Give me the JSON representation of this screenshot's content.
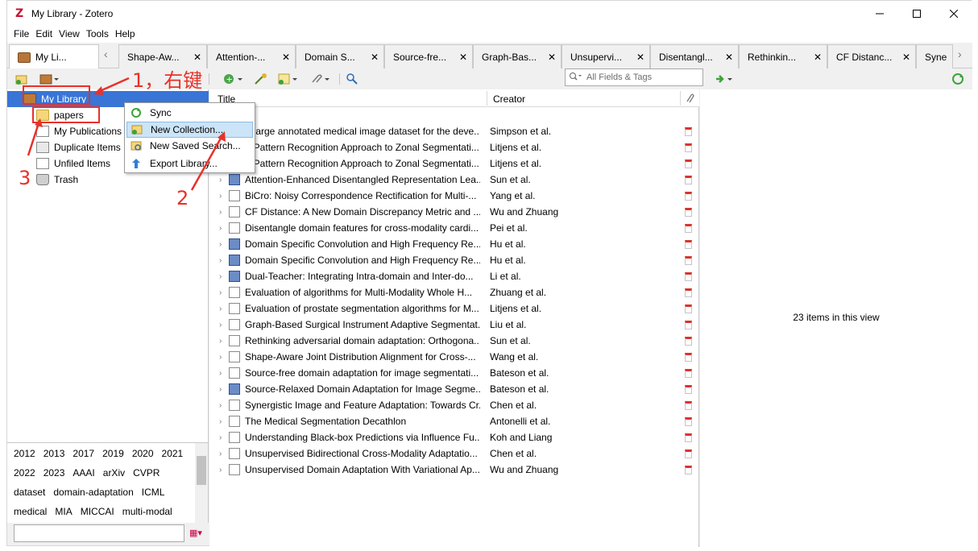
{
  "window": {
    "title": "My Library - Zotero",
    "logo": "Z",
    "minimize_icon": "minimize-icon",
    "maximize_icon": "maximize-icon",
    "close_icon": "close-icon"
  },
  "menu": [
    "File",
    "Edit",
    "View",
    "Tools",
    "Help"
  ],
  "tabs": [
    {
      "label": "My Li...",
      "active": true
    },
    {
      "label": "Shape-Aw..."
    },
    {
      "label": "Attention-..."
    },
    {
      "label": "Domain S..."
    },
    {
      "label": "Source-fre..."
    },
    {
      "label": "Graph-Bas..."
    },
    {
      "label": "Unsupervi..."
    },
    {
      "label": "Disentangl..."
    },
    {
      "label": "Rethinkin..."
    },
    {
      "label": "CF Distanc..."
    },
    {
      "label": "Syne"
    }
  ],
  "toolbar": {
    "search_placeholder": "All Fields & Tags"
  },
  "collections": [
    {
      "label": "My Library",
      "icon": "library-icon",
      "selected": true
    },
    {
      "label": "papers",
      "icon": "folder-icon"
    },
    {
      "label": "My Publications",
      "icon": "publications-icon"
    },
    {
      "label": "Duplicate Items",
      "icon": "duplicate-icon"
    },
    {
      "label": "Unfiled Items",
      "icon": "unfiled-icon"
    },
    {
      "label": "Trash",
      "icon": "trash-icon"
    }
  ],
  "context_menu": [
    {
      "label": "Sync",
      "icon": "sync-icon"
    },
    {
      "label": "New Collection...",
      "icon": "new-collection-icon",
      "highlighted": true
    },
    {
      "label": "New Saved Search...",
      "icon": "new-saved-search-icon"
    },
    {
      "label": "Export Library...",
      "icon": "export-icon"
    }
  ],
  "tags": [
    [
      "2012",
      "2013",
      "2017",
      "2019",
      "2020",
      "2021"
    ],
    [
      "2022",
      "2023",
      "AAAI",
      "arXiv",
      "CVPR"
    ],
    [
      "dataset",
      "domain-adaptation",
      "ICML"
    ],
    [
      "medical",
      "MIA",
      "MICCAI",
      "multi-modal"
    ]
  ],
  "items_pane": {
    "col_title": "Title",
    "col_creator": "Creator",
    "count_text": "23 items in this view",
    "rows": [
      {
        "title": "A large annotated medical image dataset for the deve...",
        "creator": "Simpson et al.",
        "type": "doc"
      },
      {
        "title": "A Pattern Recognition Approach to Zonal Segmentati...",
        "creator": "Litjens et al.",
        "type": "doc"
      },
      {
        "title": "A Pattern Recognition Approach to Zonal Segmentati...",
        "creator": "Litjens et al.",
        "type": "doc"
      },
      {
        "title": "Attention-Enhanced Disentangled Representation Lea...",
        "creator": "Sun et al.",
        "type": "book"
      },
      {
        "title": "BiCro: Noisy Correspondence Rectification for Multi-...",
        "creator": "Yang et al.",
        "type": "doc"
      },
      {
        "title": "CF Distance: A New Domain Discrepancy Metric and ...",
        "creator": "Wu and Zhuang",
        "type": "doc"
      },
      {
        "title": "Disentangle domain features for cross-modality cardi...",
        "creator": "Pei et al.",
        "type": "doc"
      },
      {
        "title": "Domain Specific Convolution and High Frequency Re...",
        "creator": "Hu et al.",
        "type": "book"
      },
      {
        "title": "Domain Specific Convolution and High Frequency Re...",
        "creator": "Hu et al.",
        "type": "book"
      },
      {
        "title": "Dual-Teacher: Integrating Intra-domain and Inter-do...",
        "creator": "Li et al.",
        "type": "book"
      },
      {
        "title": "Evaluation of algorithms for Multi-Modality Whole H...",
        "creator": "Zhuang et al.",
        "type": "doc"
      },
      {
        "title": "Evaluation of prostate segmentation algorithms for M...",
        "creator": "Litjens et al.",
        "type": "doc"
      },
      {
        "title": "Graph-Based Surgical Instrument Adaptive Segmentat...",
        "creator": "Liu et al.",
        "type": "doc"
      },
      {
        "title": "Rethinking adversarial domain adaptation: Orthogona...",
        "creator": "Sun et al.",
        "type": "doc"
      },
      {
        "title": "Shape-Aware Joint Distribution Alignment for Cross-...",
        "creator": "Wang et al.",
        "type": "doc"
      },
      {
        "title": "Source-free domain adaptation for image segmentati...",
        "creator": "Bateson et al.",
        "type": "doc"
      },
      {
        "title": "Source-Relaxed Domain Adaptation for Image Segme...",
        "creator": "Bateson et al.",
        "type": "book"
      },
      {
        "title": "Synergistic Image and Feature Adaptation: Towards Cr...",
        "creator": "Chen et al.",
        "type": "doc"
      },
      {
        "title": "The Medical Segmentation Decathlon",
        "creator": "Antonelli et al.",
        "type": "doc"
      },
      {
        "title": "Understanding Black-box Predictions via Influence Fu...",
        "creator": "Koh and Liang",
        "type": "doc"
      },
      {
        "title": "Unsupervised Bidirectional Cross-Modality Adaptatio...",
        "creator": "Chen et al.",
        "type": "doc"
      },
      {
        "title": "Unsupervised Domain Adaptation With Variational Ap...",
        "creator": "Wu and Zhuang",
        "type": "doc"
      }
    ]
  },
  "annotations": {
    "step1": "1，右键",
    "step2": "2",
    "step3": "3",
    "color": "#e8312a"
  }
}
